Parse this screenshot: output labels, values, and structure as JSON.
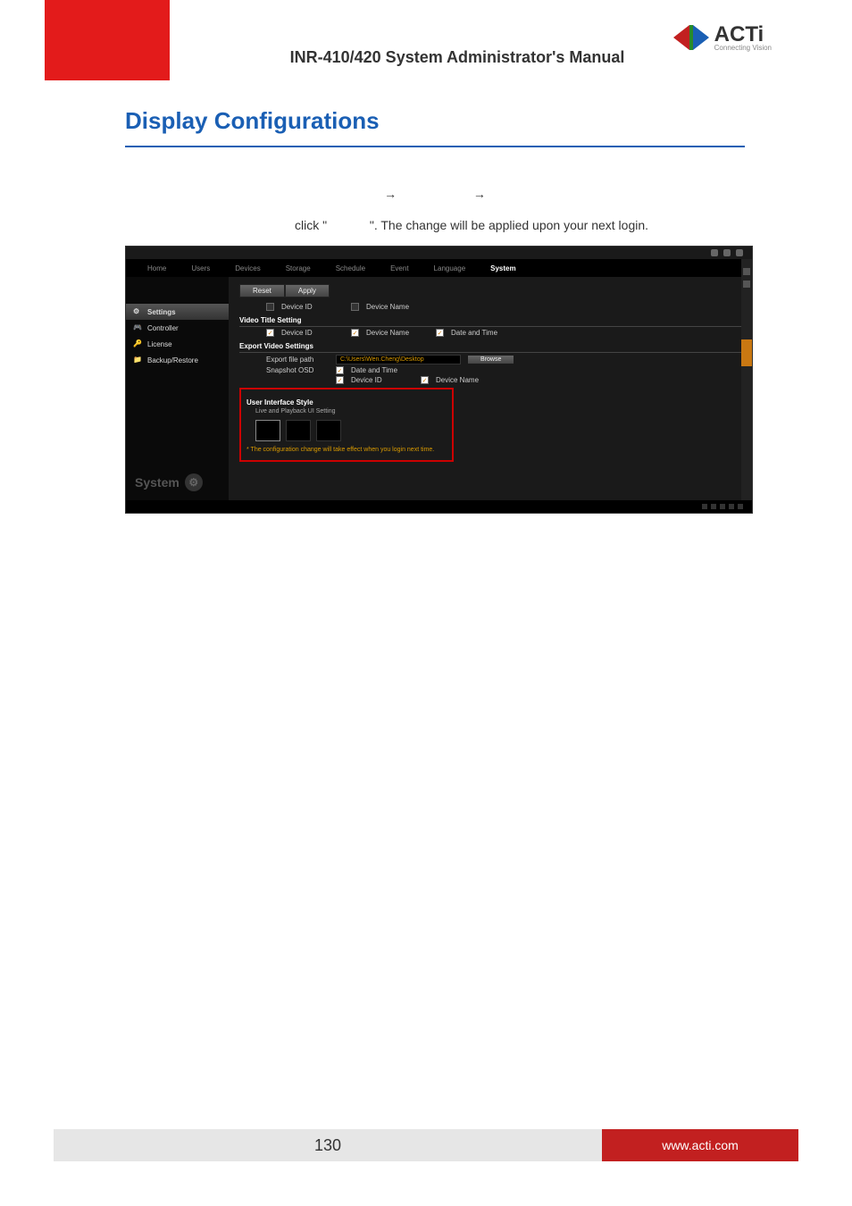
{
  "header": {
    "title": "INR-410/420 System Administrator's Manual",
    "brand_name": "ACTi",
    "brand_tag": "Connecting Vision"
  },
  "section_title": "Display Configurations",
  "intro": {
    "line1_prefix": "click \"",
    "line1_suffix": "\". The change will be applied upon your next login."
  },
  "screenshot": {
    "menu": [
      "Home",
      "Users",
      "Devices",
      "Storage",
      "Schedule",
      "Event",
      "Language",
      "System"
    ],
    "menu_active": "System",
    "sidebar": {
      "items": [
        {
          "label": "Settings",
          "active": true
        },
        {
          "label": "Controller"
        },
        {
          "label": "License"
        },
        {
          "label": "Backup/Restore"
        }
      ],
      "footer": "System"
    },
    "buttons": {
      "reset": "Reset",
      "apply": "Apply"
    },
    "top_row": {
      "device_id": "Device ID",
      "device_name": "Device Name"
    },
    "video_title": {
      "header": "Video Title Setting",
      "device_id": "Device ID",
      "device_name": "Device Name",
      "date_time": "Date and Time"
    },
    "export": {
      "header": "Export Video Settings",
      "path_label": "Export file path",
      "path_value": "C:\\Users\\Wen.Cheng\\Desktop",
      "browse": "Browse",
      "snapshot_label": "Snapshot OSD",
      "date_time": "Date and Time",
      "device_id": "Device ID",
      "device_name": "Device Name"
    },
    "ui_style": {
      "header": "User Interface Style",
      "sub": "Live and Playback UI Setting",
      "note": "* The configuration change will take effect when you login next time."
    }
  },
  "footer": {
    "page_number": "130",
    "url": "www.acti.com"
  }
}
